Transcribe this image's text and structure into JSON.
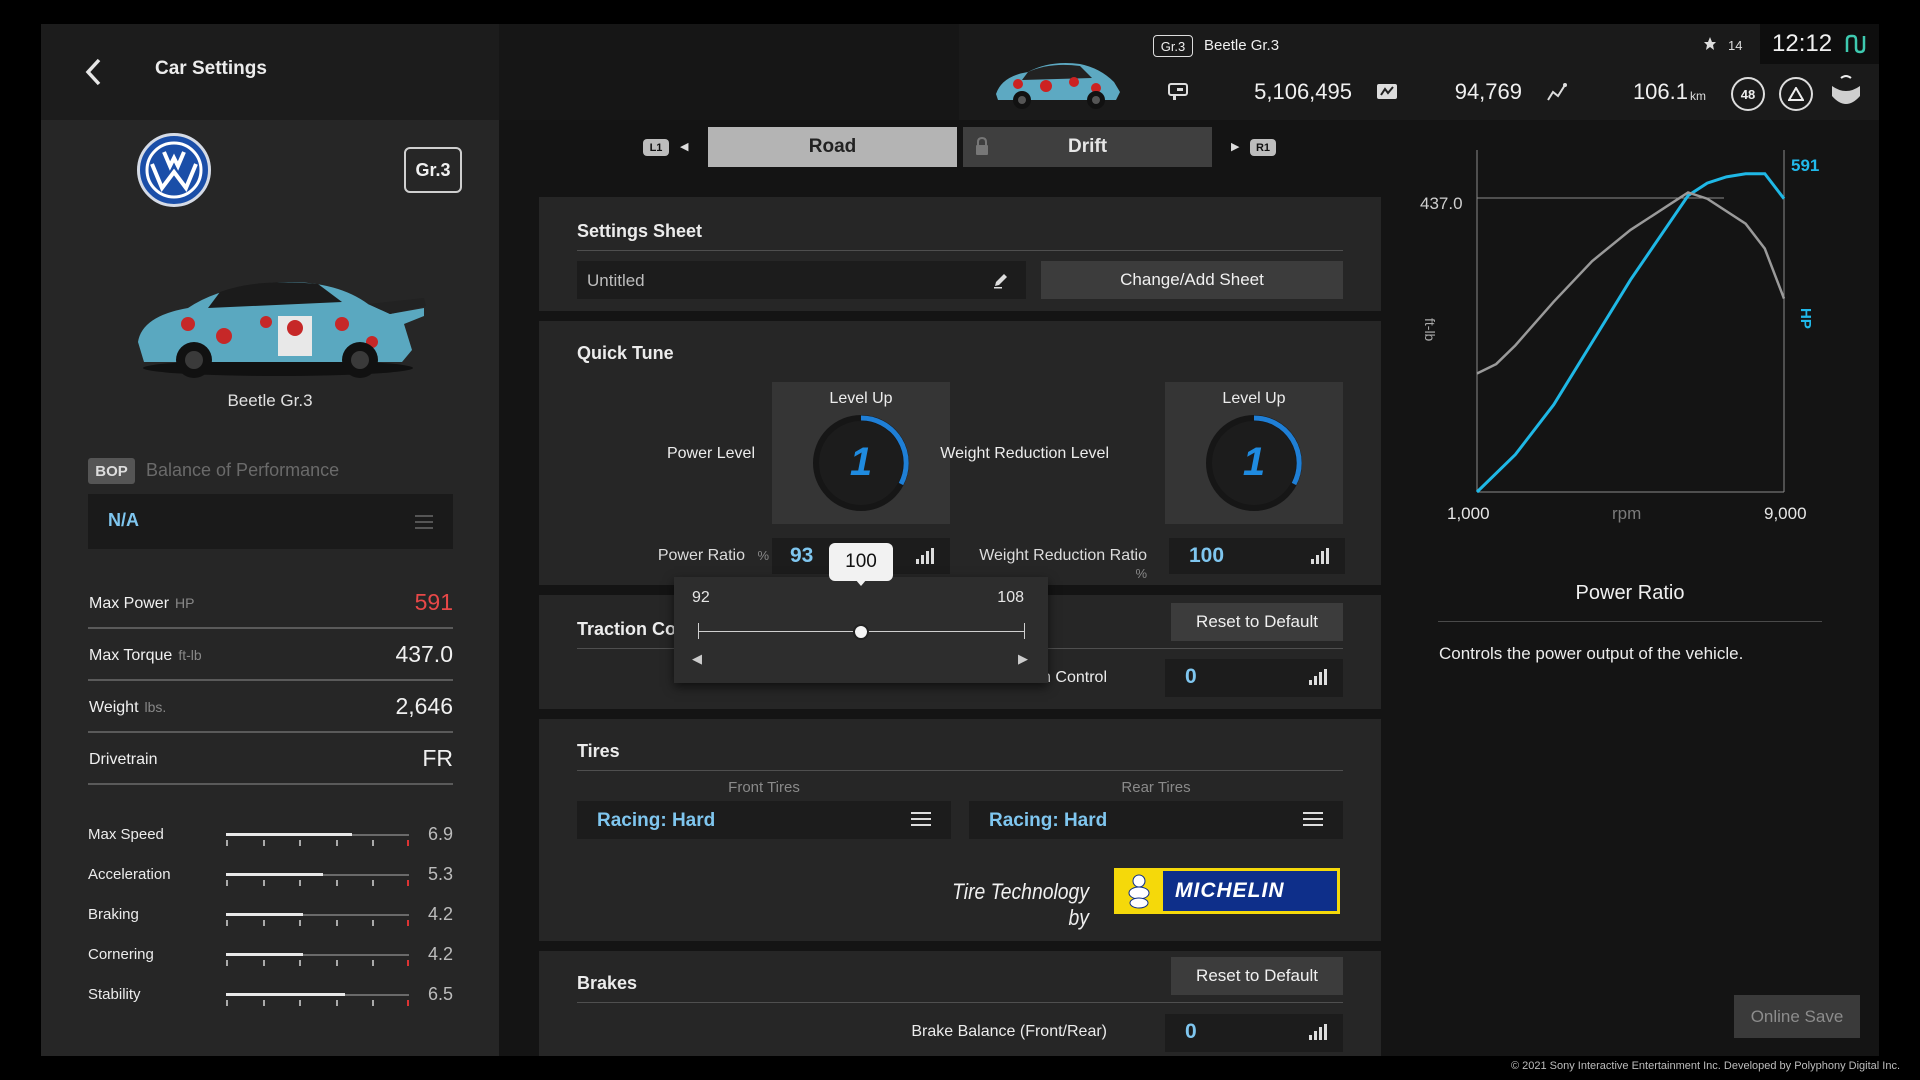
{
  "header": {
    "title": "Car Settings",
    "car_class": "Gr.3",
    "car_name": "Beetle Gr.3",
    "credits": "5,106,495",
    "mileage_points": "94,769",
    "distance": "106.1",
    "distance_unit": "km",
    "trophies": "14",
    "level": "48",
    "clock": "12:12"
  },
  "left_panel": {
    "class_badge": "Gr.3",
    "car_name": "Beetle Gr.3",
    "bop_tag": "BOP",
    "bop_label": "Balance of Performance",
    "bop_value": "N/A",
    "stats": [
      {
        "label": "Max Power",
        "unit": "HP",
        "value": "591",
        "color": "#e84848"
      },
      {
        "label": "Max Torque",
        "unit": "ft-lb",
        "value": "437.0",
        "color": "#f0f0f0"
      },
      {
        "label": "Weight",
        "unit": "lbs.",
        "value": "2,646",
        "color": "#f0f0f0"
      },
      {
        "label": "Drivetrain",
        "unit": "",
        "value": "FR",
        "color": "#f0f0f0"
      }
    ],
    "performance": [
      {
        "label": "Max Speed",
        "value": "6.9",
        "fill": 0.69
      },
      {
        "label": "Acceleration",
        "value": "5.3",
        "fill": 0.53
      },
      {
        "label": "Braking",
        "value": "4.2",
        "fill": 0.42
      },
      {
        "label": "Cornering",
        "value": "4.2",
        "fill": 0.42
      },
      {
        "label": "Stability",
        "value": "6.5",
        "fill": 0.65
      }
    ]
  },
  "tabs": {
    "l1": "L1",
    "r1": "R1",
    "road": "Road",
    "drift": "Drift"
  },
  "settings_sheet": {
    "title": "Settings Sheet",
    "name_value": "Untitled",
    "change_button": "Change/Add Sheet"
  },
  "quick_tune": {
    "title": "Quick Tune",
    "power_level_label": "Power Level",
    "power_level_header": "Level Up",
    "power_level_value": "1",
    "weight_level_label": "Weight Reduction Level",
    "weight_level_header": "Level Up",
    "weight_level_value": "1",
    "power_ratio_label": "Power Ratio",
    "power_ratio_unit": "%",
    "power_ratio_value": "93",
    "weight_ratio_label": "Weight Reduction Ratio",
    "weight_ratio_unit": "%",
    "weight_ratio_value": "100"
  },
  "slider_popup": {
    "current": "100",
    "min": "92",
    "max": "108",
    "position": 0.5
  },
  "traction": {
    "title": "Traction Control",
    "reset_button": "Reset to Default",
    "tcs_label": "Traction Control",
    "tcs_value": "0"
  },
  "tires": {
    "title": "Tires",
    "front_label": "Front Tires",
    "rear_label": "Rear Tires",
    "front_value": "Racing: Hard",
    "rear_value": "Racing: Hard",
    "tech_text": "Tire Technology by",
    "brand": "MICHELIN"
  },
  "brakes": {
    "title": "Brakes",
    "reset_button": "Reset to Default",
    "balance_label": "Brake Balance (Front/Rear)",
    "balance_value": "0"
  },
  "chart_data": {
    "type": "line",
    "xlabel": "rpm",
    "x_min_label": "1,000",
    "x_max_label": "9,000",
    "xlim": [
      1000,
      9000
    ],
    "left_axis_label": "ft-lb",
    "right_axis_label": "HP",
    "torque_peak_label": "437.0",
    "power_peak_label": "591",
    "series": [
      {
        "name": "HP",
        "color": "#1fb8e6",
        "x": [
          1000,
          2000,
          3000,
          4000,
          5000,
          6000,
          6500,
          7000,
          7500,
          8000,
          8500,
          9000
        ],
        "values": [
          0.0,
          0.12,
          0.28,
          0.48,
          0.68,
          0.86,
          0.95,
          0.99,
          1.01,
          1.02,
          1.02,
          0.94
        ]
      },
      {
        "name": "ft-lb",
        "color": "#9a9a9a",
        "x": [
          1000,
          1500,
          2000,
          3000,
          4000,
          5000,
          6000,
          6500,
          7000,
          8000,
          8500,
          9000
        ],
        "values": [
          0.38,
          0.41,
          0.47,
          0.61,
          0.74,
          0.84,
          0.92,
          0.96,
          0.94,
          0.86,
          0.78,
          0.62
        ]
      }
    ]
  },
  "info_panel": {
    "title": "Power Ratio",
    "description": "Controls the power output of the vehicle."
  },
  "footer": {
    "online_save": "Online Save",
    "copyright": "© 2021 Sony Interactive Entertainment Inc. Developed by Polyphony Digital Inc."
  }
}
